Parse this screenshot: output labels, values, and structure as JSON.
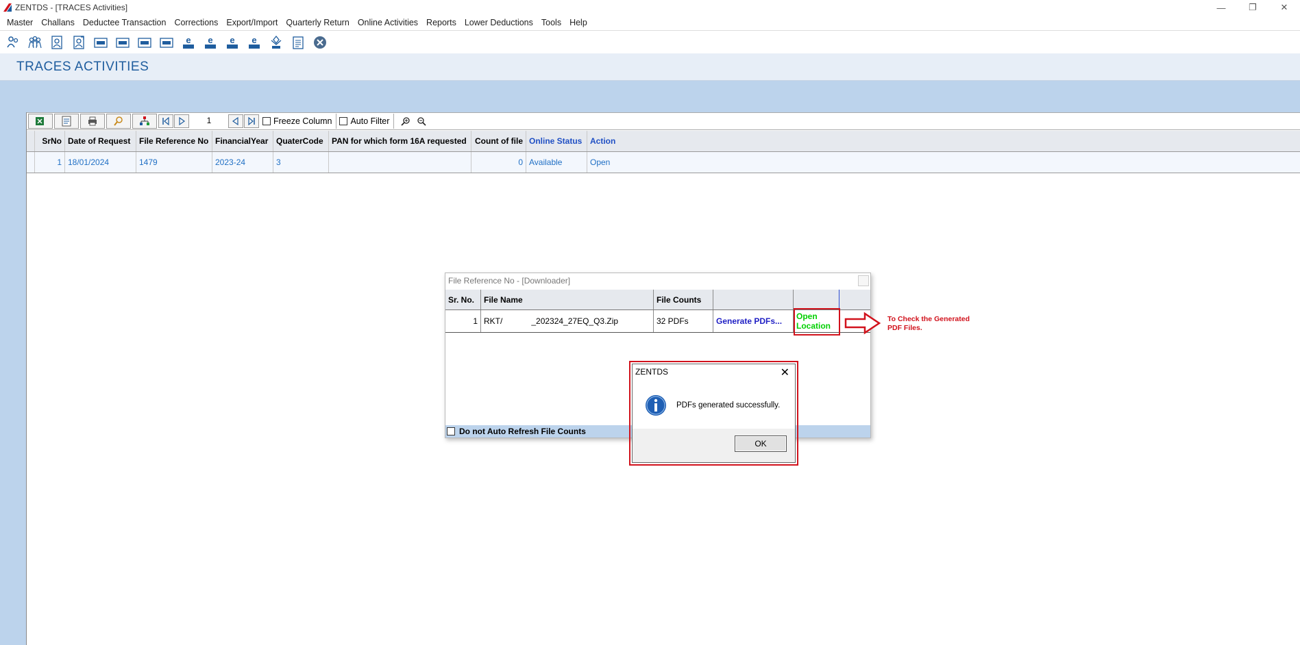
{
  "window": {
    "title": "ZENTDS - [TRACES Activities]",
    "minimize": "—",
    "restore": "❐",
    "close": "✕"
  },
  "menu": [
    "Master",
    "Challans",
    "Deductee Transaction",
    "Corrections",
    "Export/Import",
    "Quarterly Return",
    "Online Activities",
    "Reports",
    "Lower Deductions",
    "Tools",
    "Help"
  ],
  "toolbar_icons": [
    "deductor-icon",
    "deductees-icon",
    "employee-icon",
    "employee2-icon",
    "form24q-icon",
    "form26q-icon",
    "form27q-icon",
    "form27eq-icon",
    "e24q-icon",
    "e26q-icon",
    "e27q-icon",
    "e27eq-icon",
    "tds-icon",
    "notepad-icon",
    "exit-icon"
  ],
  "page": {
    "title": "TRACES ACTIVITIES"
  },
  "grid_toolbar": {
    "page_number": "1",
    "freeze_column": "Freeze Column",
    "auto_filter": "Auto Filter"
  },
  "grid": {
    "columns": [
      "SrNo",
      "Date of Request",
      "File Reference No",
      "FinancialYear",
      "QuaterCode",
      "PAN for which form 16A requested",
      "Count of file",
      "Online Status",
      "Action"
    ],
    "rows": [
      {
        "srno": "1",
        "date": "18/01/2024",
        "ref": "1479",
        "fy": "2023-24",
        "quarter": "3",
        "pan": "",
        "count": "0",
        "status": "Available",
        "action": "Open"
      }
    ]
  },
  "downloader": {
    "title": "File Reference No -  [Downloader]",
    "columns": [
      "Sr. No.",
      "File Name",
      "File Counts",
      "",
      ""
    ],
    "row": {
      "srno": "1",
      "file_prefix": "RKT/",
      "file_suffix": "_202324_27EQ_Q3.Zip",
      "counts": "32 PDFs",
      "generate": "Generate PDFs...",
      "open_location": "Open Location"
    },
    "footer_checkbox": "Do not Auto Refresh File Counts"
  },
  "message_box": {
    "title": "ZENTDS",
    "close": "✕",
    "text": "PDFs generated successfully.",
    "ok": "OK"
  },
  "annotation": {
    "text": "To Check the Generated PDF Files.",
    "color": "#d1121c"
  },
  "colors": {
    "header_blue": "#1f5d9e",
    "band": "#bcd3ec",
    "link": "#1f6fc4",
    "open_location": "#00d000"
  }
}
